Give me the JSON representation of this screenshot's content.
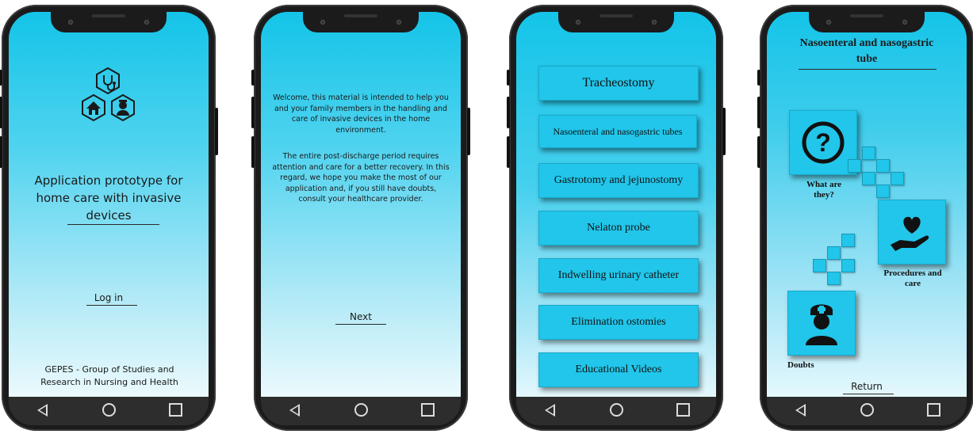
{
  "screen1": {
    "title": "Application prototype for home care with invasive devices",
    "login": "Log in",
    "footer": "GEPES - Group of Studies and Research in Nursing and Health"
  },
  "screen2": {
    "paragraph1": "Welcome, this material is intended to help you  and your family members in the handling and care of invasive devices in the home environment.",
    "paragraph2": "The entire post-discharge period requires attention and care for a better recovery. In this regard, we hope you make the most of our application and, if you still have doubts, consult your healthcare provider.",
    "next": "Next"
  },
  "screen3": {
    "menu": [
      "Tracheostomy",
      "Nasoenteral and nasogastric tubes",
      "Gastrotomy and jejunostomy",
      "Nelaton probe",
      "Indwelling urinary catheter",
      "Elimination ostomies",
      "Educational Videos"
    ]
  },
  "screen4": {
    "title": "Nasoenteral and nasogastric tube",
    "tiles": {
      "what": "What are they?",
      "procedures": "Procedures and care",
      "doubts": "Doubts"
    },
    "return": "Return"
  },
  "nav": {
    "back_icon": "back-triangle-icon",
    "home_icon": "home-circle-icon",
    "recent_icon": "recent-square-icon"
  },
  "colors": {
    "accent": "#21c6ea",
    "frame": "#1b1b1b",
    "navbar": "#2d2d2d"
  }
}
